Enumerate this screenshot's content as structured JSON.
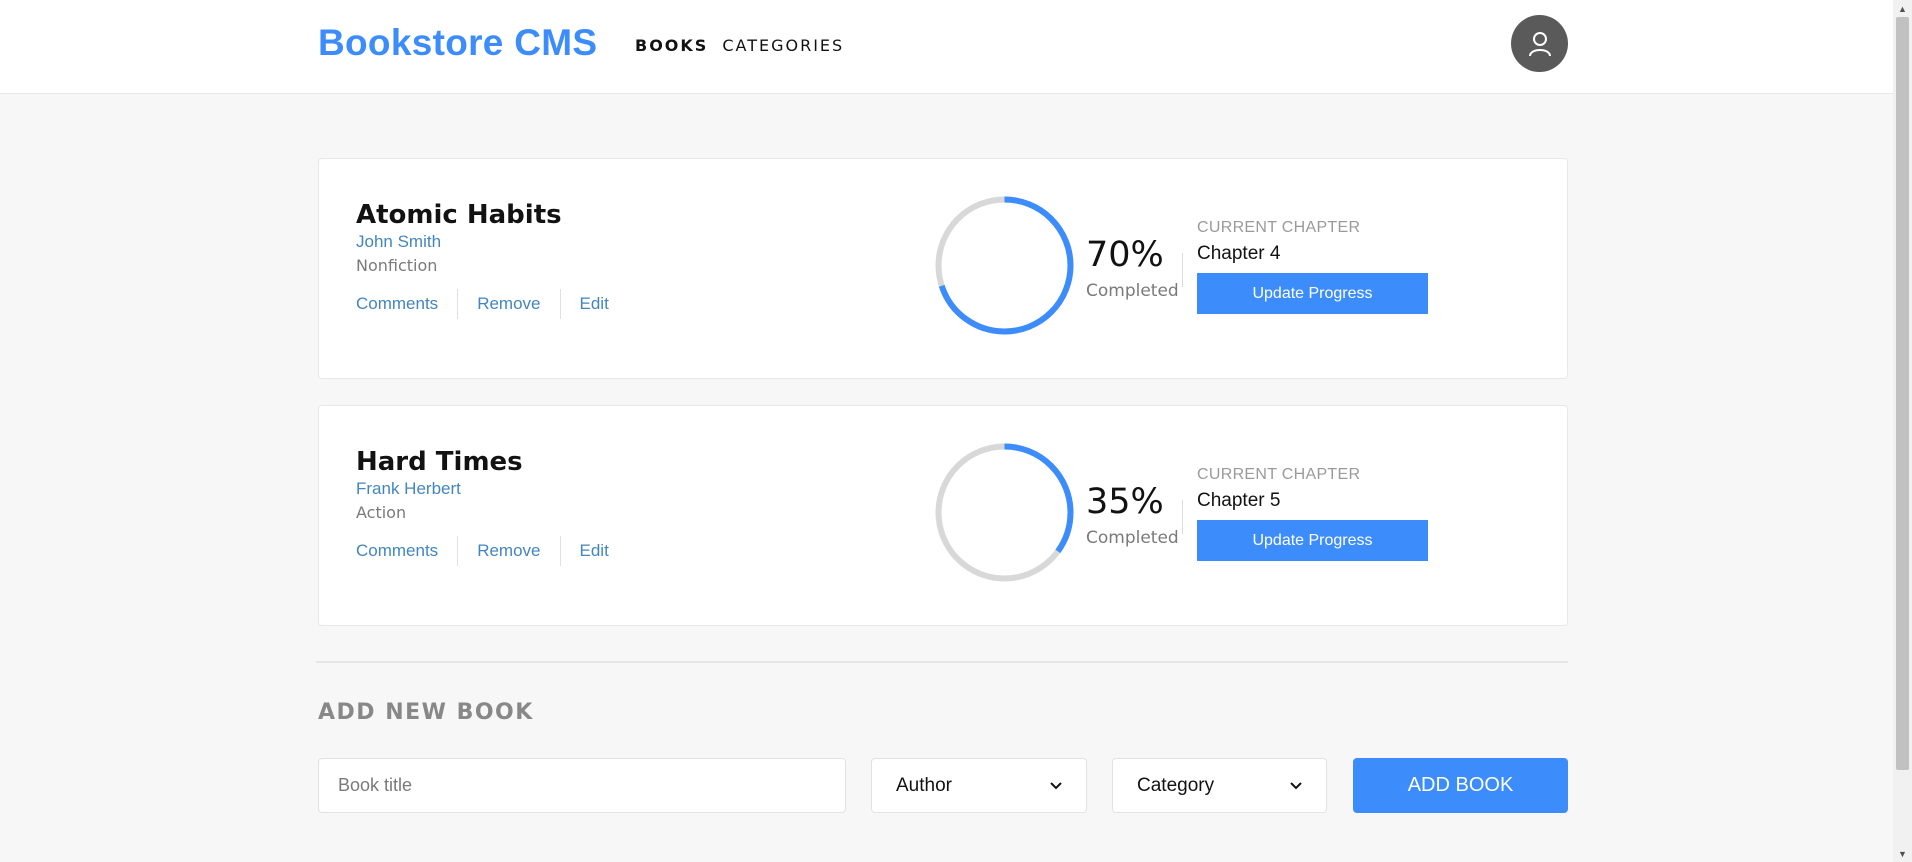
{
  "header": {
    "logo": "Bookstore CMS",
    "nav": [
      {
        "label": "BOOKS",
        "active": true
      },
      {
        "label": "CATEGORIES",
        "active": false
      }
    ],
    "avatar_icon": "user-icon"
  },
  "books": [
    {
      "title": "Atomic Habits",
      "author": "John Smith",
      "category": "Nonfiction",
      "actions": [
        "Comments",
        "Remove",
        "Edit"
      ],
      "percent_label": "70%",
      "progress": 0.7,
      "completed_label": "Completed",
      "chapter_label": "CURRENT CHAPTER",
      "chapter": "Chapter 4",
      "update_label": "Update Progress"
    },
    {
      "title": "Hard Times",
      "author": "Frank Herbert",
      "category": "Action",
      "actions": [
        "Comments",
        "Remove",
        "Edit"
      ],
      "percent_label": "35%",
      "progress": 0.35,
      "completed_label": "Completed",
      "chapter_label": "CURRENT CHAPTER",
      "chapter": "Chapter 5",
      "update_label": "Update Progress"
    }
  ],
  "add_book": {
    "heading": "ADD NEW BOOK",
    "title_placeholder": "Book title",
    "title_value": "",
    "author_select": "Author",
    "category_select": "Category",
    "submit_label": "ADD BOOK"
  },
  "colors": {
    "accent": "#3c8dfb",
    "link": "#4386bf",
    "ring_track": "#d8d8d8"
  }
}
